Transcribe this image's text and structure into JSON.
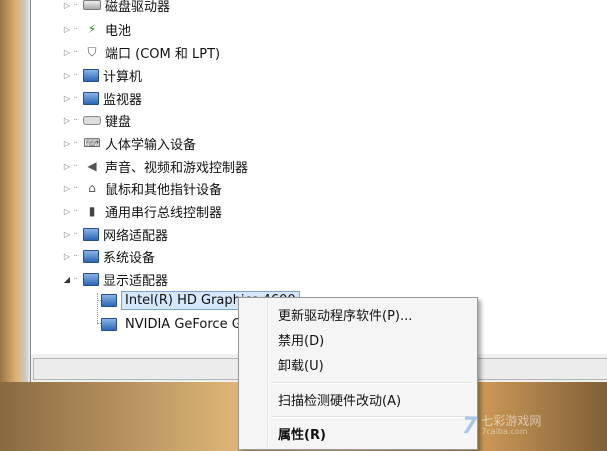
{
  "device_tree": {
    "categories": [
      {
        "label": "磁盘驱动器",
        "icon": "disk-drive-icon",
        "expanded": false
      },
      {
        "label": "电池",
        "icon": "battery-icon",
        "expanded": false
      },
      {
        "label": "端口 (COM 和 LPT)",
        "icon": "port-icon",
        "expanded": false
      },
      {
        "label": "计算机",
        "icon": "computer-icon",
        "expanded": false
      },
      {
        "label": "监视器",
        "icon": "monitor-icon",
        "expanded": false
      },
      {
        "label": "键盘",
        "icon": "keyboard-icon",
        "expanded": false
      },
      {
        "label": "人体学输入设备",
        "icon": "hid-icon",
        "expanded": false
      },
      {
        "label": "声音、视频和游戏控制器",
        "icon": "speaker-icon",
        "expanded": false
      },
      {
        "label": "鼠标和其他指针设备",
        "icon": "mouse-icon",
        "expanded": false
      },
      {
        "label": "通用串行总线控制器",
        "icon": "usb-icon",
        "expanded": false
      },
      {
        "label": "网络适配器",
        "icon": "network-adapter-icon",
        "expanded": false
      },
      {
        "label": "系统设备",
        "icon": "system-device-icon",
        "expanded": false
      },
      {
        "label": "显示适配器",
        "icon": "display-adapter-icon",
        "expanded": true
      }
    ],
    "display_adapters": [
      {
        "label": "Intel(R) HD Graphics 4600",
        "selected": true
      },
      {
        "label": "NVIDIA GeForce GTX",
        "selected": false
      }
    ]
  },
  "context_menu": {
    "items": [
      {
        "label": "更新驱动程序软件(P)...",
        "bold": false
      },
      {
        "label": "禁用(D)",
        "bold": false
      },
      {
        "label": "卸载(U)",
        "bold": false
      },
      {
        "label": "扫描检测硬件改动(A)",
        "bold": false
      },
      {
        "label": "属性(R)",
        "bold": true
      }
    ]
  },
  "watermark": {
    "logo": "7",
    "text": "七彩游戏网",
    "sub": "7caiba.com"
  },
  "colors": {
    "selection_bg": "#d5e7fb",
    "selection_border": "#7da2ce",
    "menu_bg": "#f5f5f5"
  }
}
